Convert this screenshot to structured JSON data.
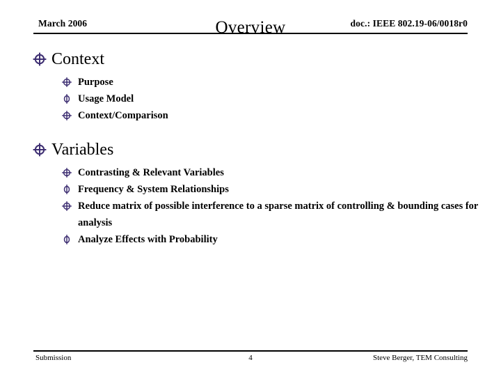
{
  "header": {
    "date": "March 2006",
    "title": "Overview",
    "doc": "doc.: IEEE 802.19-06/0018r0"
  },
  "colors": {
    "bullet": "#3E2F72",
    "text": "#000000",
    "background": "#FFFFFF",
    "rule": "#000000"
  },
  "sections": [
    {
      "heading": "Context",
      "bullet_icon": "crossed-circle-icon",
      "items": [
        {
          "text": "Purpose",
          "bullet_icon": "crossed-circle-icon"
        },
        {
          "text": "Usage Model",
          "bullet_icon": "phi-circle-icon"
        },
        {
          "text": "Context/Comparison",
          "bullet_icon": "crossed-circle-icon"
        }
      ]
    },
    {
      "heading": "Variables",
      "bullet_icon": "crossed-circle-icon",
      "items": [
        {
          "text": "Contrasting & Relevant Variables",
          "bullet_icon": "crossed-circle-icon"
        },
        {
          "text": "Frequency & System Relationships",
          "bullet_icon": "phi-circle-icon"
        },
        {
          "text": "Reduce matrix of possible interference to a sparse matrix of controlling & bounding cases for analysis",
          "bullet_icon": "crossed-circle-icon"
        },
        {
          "text": "Analyze Effects with Probability",
          "bullet_icon": "phi-circle-icon"
        }
      ]
    }
  ],
  "footer": {
    "left": "Submission",
    "page_number": "4",
    "right": "Steve Berger, TEM Consulting"
  }
}
